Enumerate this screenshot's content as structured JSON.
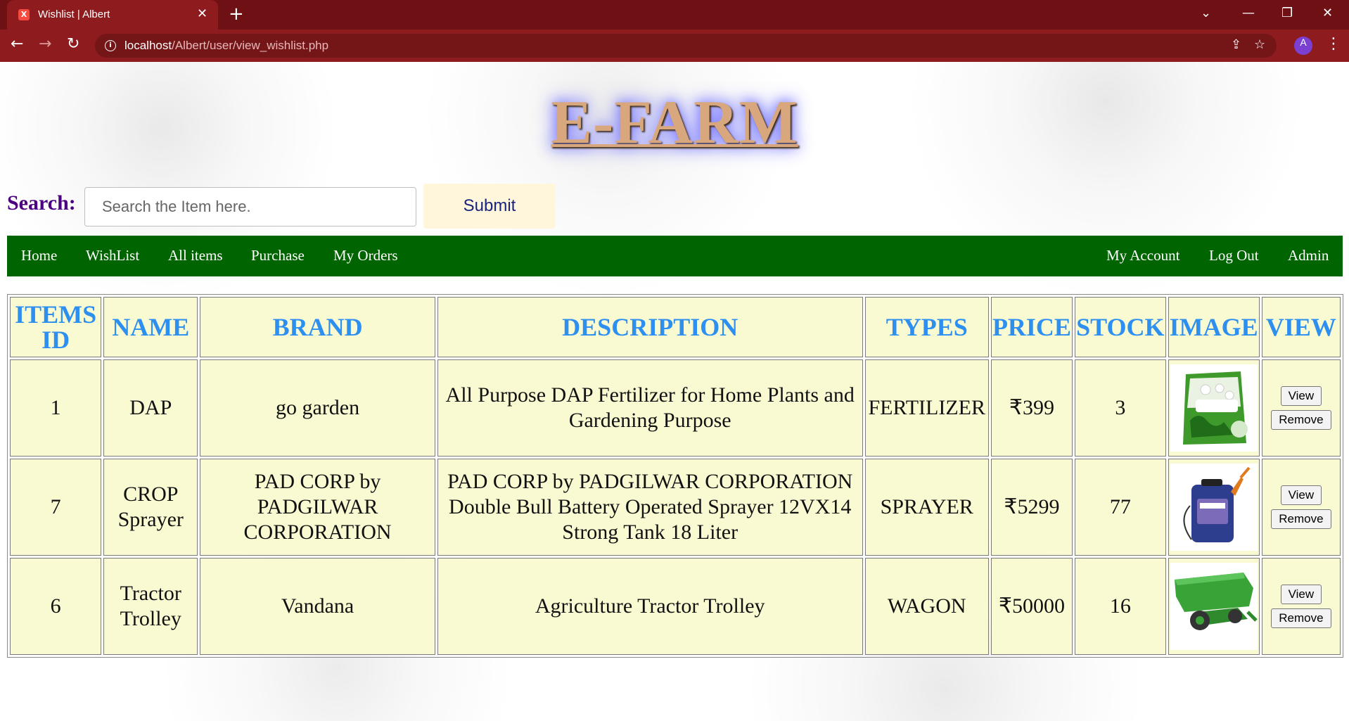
{
  "browser": {
    "tab_title": "Wishlist | Albert",
    "url_host": "localhost",
    "url_path": "/Albert/user/view_wishlist.php",
    "avatar_letter": "A"
  },
  "site": {
    "logo": "E-FARM",
    "search_label": "Search:",
    "search_placeholder": "Search the Item here.",
    "submit_label": "Submit"
  },
  "nav": {
    "left": [
      "Home",
      "WishList",
      "All items",
      "Purchase",
      "My Orders"
    ],
    "right": [
      "My Account",
      "Log Out",
      "Admin"
    ]
  },
  "table": {
    "headers": [
      "ITEMS ID",
      "NAME",
      "BRAND",
      "DESCRIPTION",
      "TYPES",
      "PRICE",
      "STOCK",
      "IMAGE",
      "VIEW"
    ],
    "view_label": "View",
    "remove_label": "Remove",
    "rows": [
      {
        "id": "1",
        "name": "DAP",
        "brand": "go garden",
        "description": "All Purpose DAP Fertilizer for Home Plants and Gardening Purpose",
        "type": "FERTILIZER",
        "price": "₹399",
        "stock": "3",
        "image": "dap-fertilizer-bag"
      },
      {
        "id": "7",
        "name": "CROP Sprayer",
        "brand": "PAD CORP by PADGILWAR CORPORATION",
        "description": "PAD CORP by PADGILWAR CORPORATION Double Bull Battery Operated Sprayer 12VX14 Strong Tank 18 Liter",
        "type": "SPRAYER",
        "price": "₹5299",
        "stock": "77",
        "image": "battery-sprayer"
      },
      {
        "id": "6",
        "name": "Tractor Trolley",
        "brand": "Vandana",
        "description": "Agriculture Tractor Trolley",
        "type": "WAGON",
        "price": "₹50000",
        "stock": "16",
        "image": "green-tractor-trolley"
      }
    ]
  },
  "colors": {
    "tabstrip": "#6e1014",
    "toolbar": "#8e1b1e",
    "navbar": "#006400",
    "table_cell": "#fafad2",
    "header_text": "#2d8ff0",
    "search_label": "#4b0082"
  }
}
